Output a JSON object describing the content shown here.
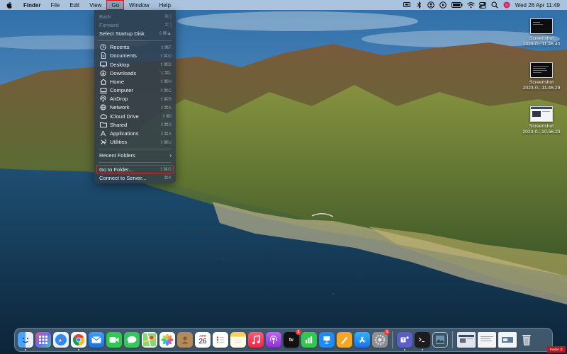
{
  "menubar": {
    "app_name": "Finder",
    "items": [
      "File",
      "Edit",
      "View",
      "Go",
      "Window",
      "Help"
    ],
    "clock": "Wed 26 Apr  11:49"
  },
  "go_menu": {
    "top": [
      {
        "label": "Back",
        "shortcut": "⌘ [",
        "disabled": true
      },
      {
        "label": "Forward",
        "shortcut": "⌘ ]",
        "disabled": true
      },
      {
        "label": "Select Startup Disk",
        "shortcut": "⇧⌘▲",
        "disabled": false
      }
    ],
    "places": [
      {
        "label": "Recents",
        "shortcut": "⇧⌘F",
        "icon": "clock-icon"
      },
      {
        "label": "Documents",
        "shortcut": "⇧⌘O",
        "icon": "document-icon"
      },
      {
        "label": "Desktop",
        "shortcut": "⇧⌘D",
        "icon": "desktop-icon"
      },
      {
        "label": "Downloads",
        "shortcut": "⌥⌘L",
        "icon": "download-icon"
      },
      {
        "label": "Home",
        "shortcut": "⇧⌘H",
        "icon": "home-icon"
      },
      {
        "label": "Computer",
        "shortcut": "⇧⌘C",
        "icon": "computer-icon"
      },
      {
        "label": "AirDrop",
        "shortcut": "⇧⌘R",
        "icon": "airdrop-icon"
      },
      {
        "label": "Network",
        "shortcut": "⇧⌘K",
        "icon": "network-icon"
      },
      {
        "label": "iCloud Drive",
        "shortcut": "⇧⌘I",
        "icon": "cloud-icon"
      },
      {
        "label": "Shared",
        "shortcut": "⇧⌘S",
        "icon": "shared-folder-icon"
      },
      {
        "label": "Applications",
        "shortcut": "⇧⌘A",
        "icon": "applications-icon"
      },
      {
        "label": "Utilities",
        "shortcut": "⇧⌘U",
        "icon": "utilities-icon"
      }
    ],
    "recent_folders": "Recent Folders",
    "go_to_folder": {
      "label": "Go to Folder...",
      "shortcut": "⇧⌘G"
    },
    "connect": {
      "label": "Connect to Server...",
      "shortcut": "⌘K"
    }
  },
  "desktop_files": [
    {
      "name_line1": "Screenshot",
      "name_line2": "2023-0...11.46.40",
      "thumb": "dark"
    },
    {
      "name_line1": "Screenshot",
      "name_line2": "2023-0...11.46.29",
      "thumb": "dark"
    },
    {
      "name_line1": "Screenshot",
      "name_line2": "2023-0...10.56.23",
      "thumb": "light"
    }
  ],
  "dock": {
    "calendar_month": "APR",
    "calendar_day": "26",
    "tv_badge": "1",
    "settings_badge": "1",
    "tv_label": "tv"
  },
  "corner_label": "Finder Ⓧ"
}
